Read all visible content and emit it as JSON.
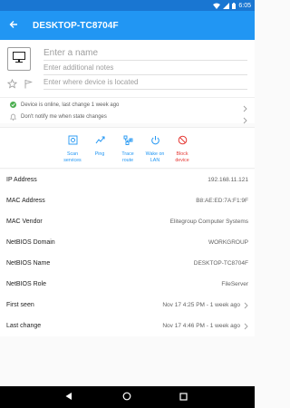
{
  "status_bar": {
    "time": "6:05"
  },
  "app_bar": {
    "title": "DESKTOP-TC8704F"
  },
  "device": {
    "name_placeholder": "Enter a name",
    "notes_placeholder": "Enter additional notes",
    "location_placeholder": "Enter where device is located"
  },
  "status": {
    "online_text": "Device is online, last change 1 week ago",
    "notify_text": "Don't notify me when state changes"
  },
  "actions": [
    {
      "label": "Scan\nservices"
    },
    {
      "label": "Ping"
    },
    {
      "label": "Trace\nroute"
    },
    {
      "label": "Wake on\nLAN"
    },
    {
      "label": "Block\ndevice"
    }
  ],
  "details": [
    {
      "key": "IP Address",
      "value": "192.168.11.121"
    },
    {
      "key": "MAC Address",
      "value": "B8:AE:ED:7A:F1:9F"
    },
    {
      "key": "MAC Vendor",
      "value": "Elitegroup Computer Systems"
    },
    {
      "key": "NetBIOS Domain",
      "value": "WORKGROUP"
    },
    {
      "key": "NetBIOS Name",
      "value": "DESKTOP-TC8704F"
    },
    {
      "key": "NetBIOS Role",
      "value": "FileServer"
    },
    {
      "key": "First seen",
      "value": "Nov 17 4:25 PM - 1 week ago"
    },
    {
      "key": "Last change",
      "value": "Nov 17 4:46 PM - 1 week ago"
    }
  ],
  "colors": {
    "primary": "#2196f3",
    "primary_dark": "#1976d2",
    "online": "#4caf50",
    "danger": "#e53935"
  },
  "icons": {
    "status_bar": [
      "wifi-icon",
      "signal-icon",
      "battery-icon"
    ],
    "header": [
      "back-arrow-icon",
      "monitor-icon",
      "star-icon",
      "flag-icon"
    ],
    "status": [
      "check-circle-icon",
      "bell-icon",
      "chevron-right-icon"
    ],
    "actions": [
      "scan-services-icon",
      "ping-icon",
      "trace-route-icon",
      "power-icon",
      "block-icon"
    ],
    "nav": [
      "back-icon",
      "home-icon",
      "recents-icon"
    ]
  }
}
